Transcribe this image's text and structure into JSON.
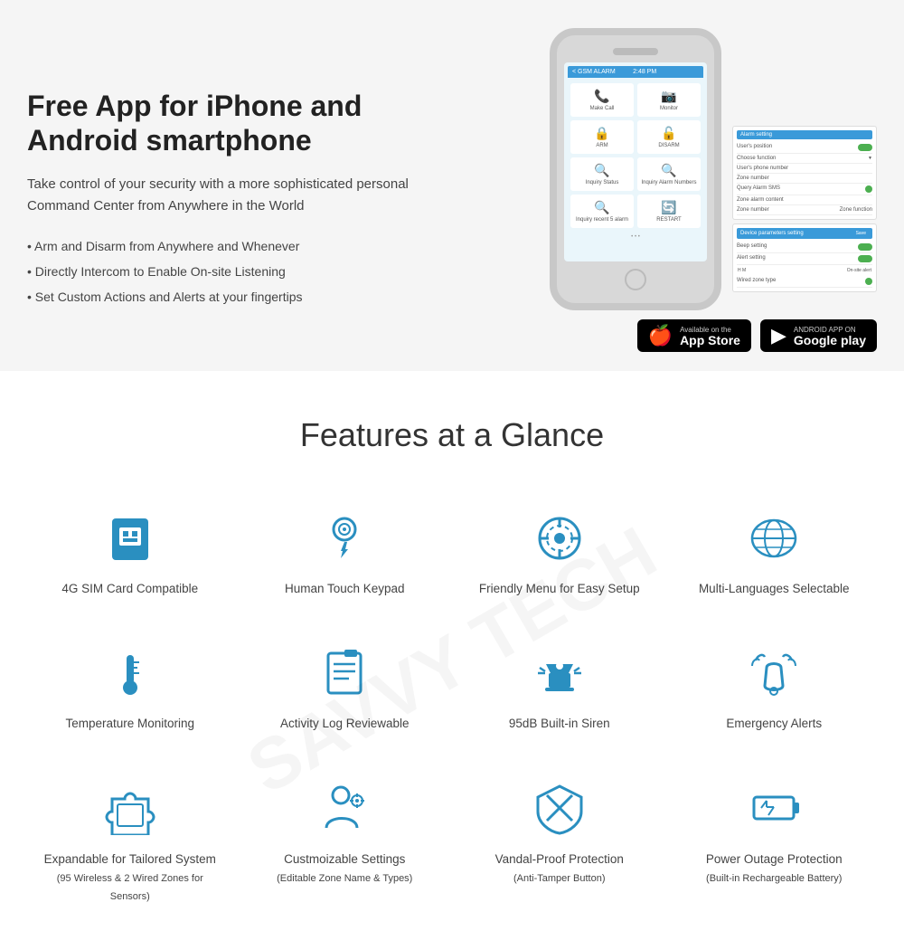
{
  "header": {
    "title": "Free App for iPhone and Android smartphone",
    "description": "Take control of your security with a more sophisticated personal Command Center from Anywhere in the World",
    "bullets": [
      "• Arm and Disarm from Anywhere and Whenever",
      "• Directly Intercom to Enable On-site Listening",
      "• Set Custom Actions and Alerts at your fingertips"
    ]
  },
  "appstore": {
    "ios_available": "Available on the",
    "ios_name": "App Store",
    "android_available": "ANDROID APP ON",
    "android_name": "Google play"
  },
  "features": {
    "section_title": "Features at a Glance",
    "items": [
      {
        "id": "sim",
        "label": "4G SIM Card Compatible"
      },
      {
        "id": "touch",
        "label": "Human Touch Keypad"
      },
      {
        "id": "menu",
        "label": "Friendly Menu for Easy Setup"
      },
      {
        "id": "lang",
        "label": "Multi-Languages Selectable"
      },
      {
        "id": "temp",
        "label": "Temperature Monitoring"
      },
      {
        "id": "log",
        "label": "Activity Log Reviewable"
      },
      {
        "id": "siren",
        "label": "95dB Built-in Siren"
      },
      {
        "id": "alert",
        "label": "Emergency Alerts"
      },
      {
        "id": "expand",
        "label": "Expandable for Tailored System\n(95 Wireless & 2 Wired Zones for Sensors)"
      },
      {
        "id": "custom",
        "label": "Custmoizable Settings\n(Editable Zone Name & Types)"
      },
      {
        "id": "vandal",
        "label": "Vandal-Proof Protection\n(Anti-Tamper Button)"
      },
      {
        "id": "power",
        "label": "Power Outage Protection\n(Built-in Rechargeable Battery)"
      }
    ]
  },
  "phone": {
    "screen_header": "< GSM ALARM",
    "cells": [
      {
        "icon": "📞",
        "label": "Make Call"
      },
      {
        "icon": "📷",
        "label": "Monitor"
      },
      {
        "icon": "🔒",
        "label": "ARM"
      },
      {
        "icon": "🔓",
        "label": "DISARM"
      },
      {
        "icon": "🔍",
        "label": "Inquiry Status"
      },
      {
        "icon": "🔍",
        "label": "Inquiry Alarm Numbers"
      },
      {
        "icon": "🔍",
        "label": "Inquiry recent 5 alarm"
      },
      {
        "icon": "🔄",
        "label": "RESTART"
      }
    ]
  }
}
